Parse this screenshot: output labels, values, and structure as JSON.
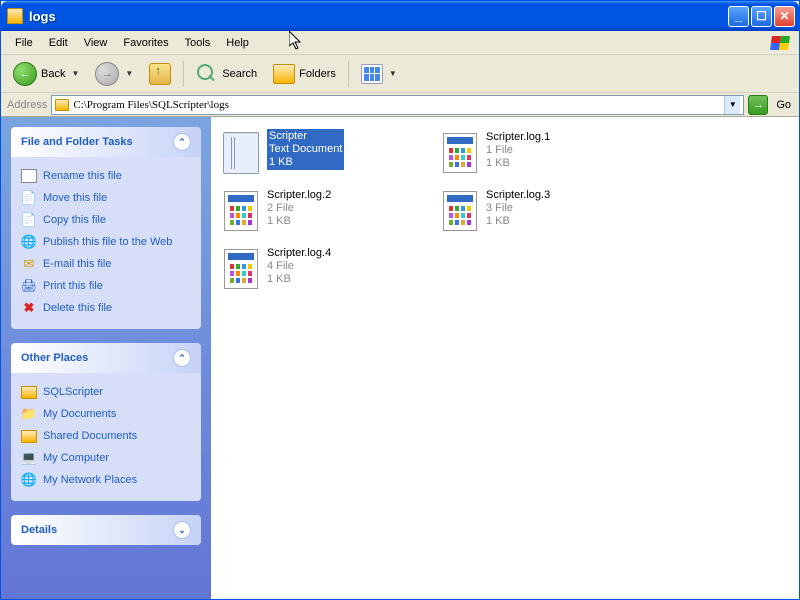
{
  "window": {
    "title": "logs"
  },
  "menu": {
    "file": "File",
    "edit": "Edit",
    "view": "View",
    "favorites": "Favorites",
    "tools": "Tools",
    "help": "Help"
  },
  "toolbar": {
    "back": "Back",
    "search": "Search",
    "folders": "Folders"
  },
  "address": {
    "label": "Address",
    "path": "C:\\Program Files\\SQLScripter\\logs",
    "go": "Go"
  },
  "sidepanel": {
    "tasks": {
      "title": "File and Folder Tasks",
      "items": [
        {
          "label": "Rename this file",
          "icon": "rename"
        },
        {
          "label": "Move this file",
          "icon": "move"
        },
        {
          "label": "Copy this file",
          "icon": "copy"
        },
        {
          "label": "Publish this file to the Web",
          "icon": "web"
        },
        {
          "label": "E-mail this file",
          "icon": "mail"
        },
        {
          "label": "Print this file",
          "icon": "print"
        },
        {
          "label": "Delete this file",
          "icon": "delete"
        }
      ]
    },
    "places": {
      "title": "Other Places",
      "items": [
        {
          "label": "SQLScripter",
          "icon": "folder"
        },
        {
          "label": "My Documents",
          "icon": "docs"
        },
        {
          "label": "Shared Documents",
          "icon": "folder"
        },
        {
          "label": "My Computer",
          "icon": "computer"
        },
        {
          "label": "My Network Places",
          "icon": "network"
        }
      ]
    },
    "details": {
      "title": "Details"
    }
  },
  "files": [
    {
      "name": "Scripter",
      "line2": "Text Document",
      "line3": "1 KB",
      "type": "txt",
      "selected": true
    },
    {
      "name": "Scripter.log.1",
      "line2": "1 File",
      "line3": "1 KB",
      "type": "app",
      "selected": false
    },
    {
      "name": "Scripter.log.2",
      "line2": "2 File",
      "line3": "1 KB",
      "type": "app",
      "selected": false
    },
    {
      "name": "Scripter.log.3",
      "line2": "3 File",
      "line3": "1 KB",
      "type": "app",
      "selected": false
    },
    {
      "name": "Scripter.log.4",
      "line2": "4 File",
      "line3": "1 KB",
      "type": "app",
      "selected": false
    }
  ]
}
